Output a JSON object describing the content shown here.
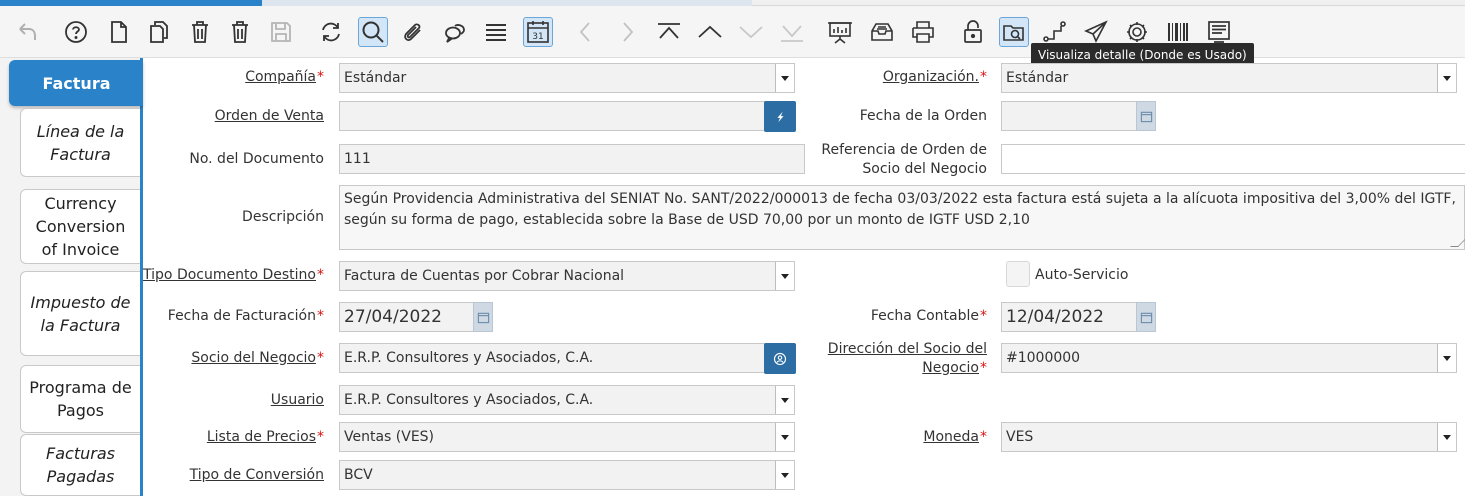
{
  "toolbar": {
    "tooltip": "Visualiza detalle (Donde es Usado)",
    "icons": [
      "undo-icon",
      "help-icon",
      "new-record-icon",
      "copy-icon",
      "delete-icon",
      "delete-selected-icon",
      "save-icon",
      "refresh-icon",
      "find-icon",
      "attachment-icon",
      "chat-icon",
      "grid-toggle-icon",
      "calendar-icon",
      "previous-icon",
      "next-icon",
      "first-record-icon",
      "parent-record-icon",
      "detail-record-icon",
      "last-record-icon",
      "report-icon",
      "archive-icon",
      "print-icon",
      "lock-icon",
      "zoom-across-icon",
      "workflow-icon",
      "send-icon",
      "process-icon",
      "product-info-icon",
      "toggle-view-icon"
    ],
    "calendar_day": "31"
  },
  "tabs": [
    {
      "label": "Factura",
      "active": true,
      "italic": false
    },
    {
      "label": "Línea de la Factura",
      "active": false,
      "italic": true
    },
    {
      "label": "Currency Conversion of Invoice",
      "active": false,
      "italic": false
    },
    {
      "label": "Impuesto de la Factura",
      "active": false,
      "italic": true
    },
    {
      "label": "Programa de Pagos",
      "active": false,
      "italic": false
    },
    {
      "label": "Facturas Pagadas",
      "active": false,
      "italic": true
    }
  ],
  "form": {
    "compania": {
      "label": "Compañía",
      "value": "Estándar"
    },
    "organizacion": {
      "label": "Organización.",
      "value": "Estándar"
    },
    "orden_venta": {
      "label": "Orden de Venta",
      "value": ""
    },
    "fecha_orden": {
      "label": "Fecha de la Orden",
      "value": ""
    },
    "no_documento": {
      "label": "No. del Documento",
      "value": "111"
    },
    "referencia_orden": {
      "label_line1": "Referencia de Orden de",
      "label_line2": "Socio del Negocio",
      "value": ""
    },
    "descripcion": {
      "label": "Descripción",
      "value": "Según Providencia Administrativa del SENIAT No. SANT/2022/000013 de fecha 03/03/2022 esta factura está sujeta a la alícuota impositiva del  3,00% del IGTF, según su forma de pago, establecida sobre la Base de USD 70,00 por un monto de IGTF USD 2,10"
    },
    "tipo_documento": {
      "label": "Tipo Documento Destino",
      "value": "Factura de Cuentas por Cobrar Nacional"
    },
    "auto_servicio": {
      "label": "Auto-Servicio",
      "checked": false
    },
    "fecha_facturacion": {
      "label": "Fecha de Facturación",
      "value": "27/04/2022"
    },
    "fecha_contable": {
      "label": "Fecha Contable",
      "value": "12/04/2022"
    },
    "socio_negocio": {
      "label": "Socio del Negocio",
      "value": "E.R.P. Consultores y Asociados, C.A."
    },
    "direccion_socio": {
      "label_line1": "Dirección del Socio del",
      "label_line2": "Negocio",
      "value": "#1000000"
    },
    "usuario": {
      "label": "Usuario",
      "value": "E.R.P. Consultores y Asociados, C.A."
    },
    "lista_precios": {
      "label": "Lista de Precios",
      "value": "Ventas (VES)"
    },
    "moneda": {
      "label": "Moneda",
      "value": "VES"
    },
    "tipo_conversion": {
      "label": "Tipo de Conversión",
      "value": "BCV"
    }
  },
  "colors": {
    "accent": "#2a83c8",
    "required": "#dd1111",
    "button": "#2c6ea3"
  }
}
